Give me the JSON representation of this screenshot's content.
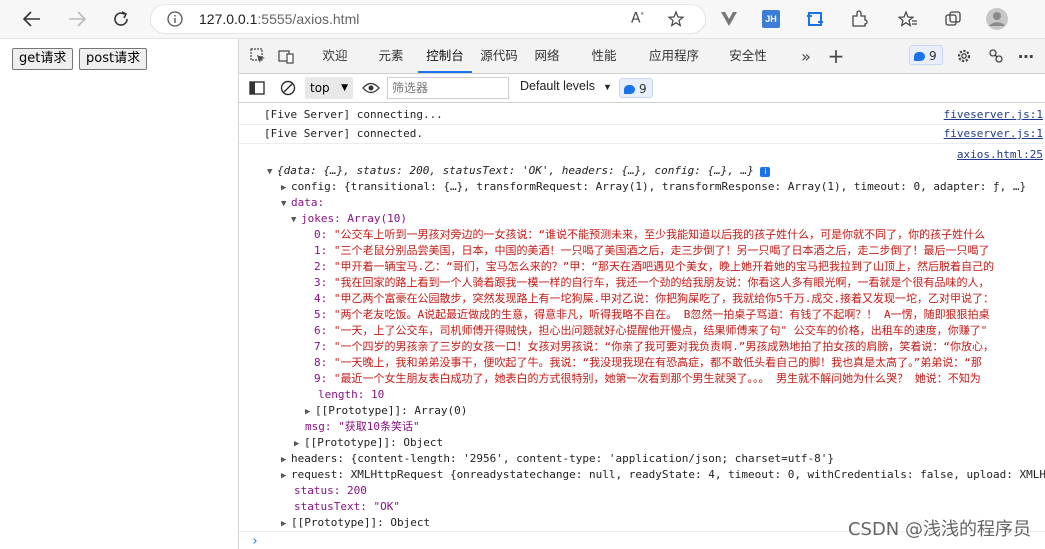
{
  "browser": {
    "url_host": "127.0.0.1",
    "url_rest": ":5555/axios.html"
  },
  "page": {
    "buttons": [
      "get请求",
      "post请求"
    ]
  },
  "devtools": {
    "tabs": [
      "欢迎",
      "元素",
      "控制台",
      "源代码",
      "网络",
      "性能",
      "应用程序",
      "安全性"
    ],
    "issues_count": "9",
    "context": "top",
    "filter_placeholder": "筛选器",
    "levels": "Default levels",
    "message_count": "9"
  },
  "console": {
    "lines": [
      {
        "text": "[Five Server] connecting...",
        "src": "fiveserver.js:1"
      },
      {
        "text": "[Five Server] connected.",
        "src": "fiveserver.js:1"
      }
    ],
    "log_src": "axios.html:25",
    "summary": "{data: {…}, status: 200, statusText: 'OK', headers: {…}, config: {…}, …}",
    "config": "config: {transitional: {…}, transformRequest: Array(1), transformResponse: Array(1), timeout: 0, adapter: ƒ, …}",
    "data_key": "data:",
    "jokes_label": "jokes: Array(10)",
    "jokes": [
      "\"公交车上听到一男孩对旁边的一女孩说：“谁说不能预测未来，至少我能知道以后我的孩子姓什么，可是你就不同了，你的孩子姓什么",
      "\"三个老鼠分别品尝美国，日本，中国的美酒！一只喝了美国酒之后，走三步倒了！另一只喝了日本酒之后，走二步倒了！最后一只喝了",
      "\"甲开着一辆宝马.乙：“哥们，宝马怎么来的？”甲：“那天在酒吧遇见个美女，晚上她开着她的宝马把我拉到了山顶上，然后脱着自己的",
      "\"我在回家的路上看到一个人骑着跟我一模一样的自行车，我还一个劲的给我朋友说：你看这人多有眼光啊，一看就是个很有品味的人，",
      "\"甲乙两个富豪在公园散步，突然发现路上有一坨狗屎.甲对乙说：你把狗屎吃了，我就给你5千万.成交.接着又发现一坨，乙对甲说了：",
      "\"两个老友吃饭。A说起最近做成的生意，得意非凡，听得我略不自在。 B忽然一拍桌子骂道：有钱了不起啊？！ A一愣，随即狠狠拍桌",
      "\"一天，上了公交车，司机师傅开得贼快，担心出问题就好心提醒他开慢点，结果师傅来了句\" 公交车的价格，出租车的速度，你赚了\"",
      "\"一个四岁的男孩亲了三岁的女孩一口！女孩对男孩说：“你亲了我可要对我负责啊.”男孩成熟地拍了拍女孩的肩膀，笑着说：“你放心，",
      "\"一天晚上，我和弟弟没事干，便吹起了牛。我说：“我没现我现在有恐高症，都不敢低头看自己的脚！我也真是太高了。”弟弟说：“那",
      "\"最近一个女生朋友表白成功了，她表白的方式很特别，她第一次看到那个男生就哭了。。。 男生就不解问她为什么哭？ 她说：不知为"
    ],
    "length": "length: 10",
    "proto_array": "[[Prototype]]: Array(0)",
    "msg": "msg: \"获取10条笑话\"",
    "proto_object": "[[Prototype]]: Object",
    "headers": "headers: {content-length: '2956', content-type: 'application/json; charset=utf-8'}",
    "request": "request: XMLHttpRequest {onreadystatechange: null, readyState: 4, timeout: 0, withCredentials: false, upload: XMLH",
    "status": "status: 200",
    "status_text": "statusText: \"OK\"",
    "proto_object2": "[[Prototype]]: Object",
    "prompt": "›"
  },
  "watermark": "CSDN @浅浅的程序员",
  "colors": {
    "accent": "#1a73e8",
    "string": "#c41a16",
    "key": "#881280"
  }
}
